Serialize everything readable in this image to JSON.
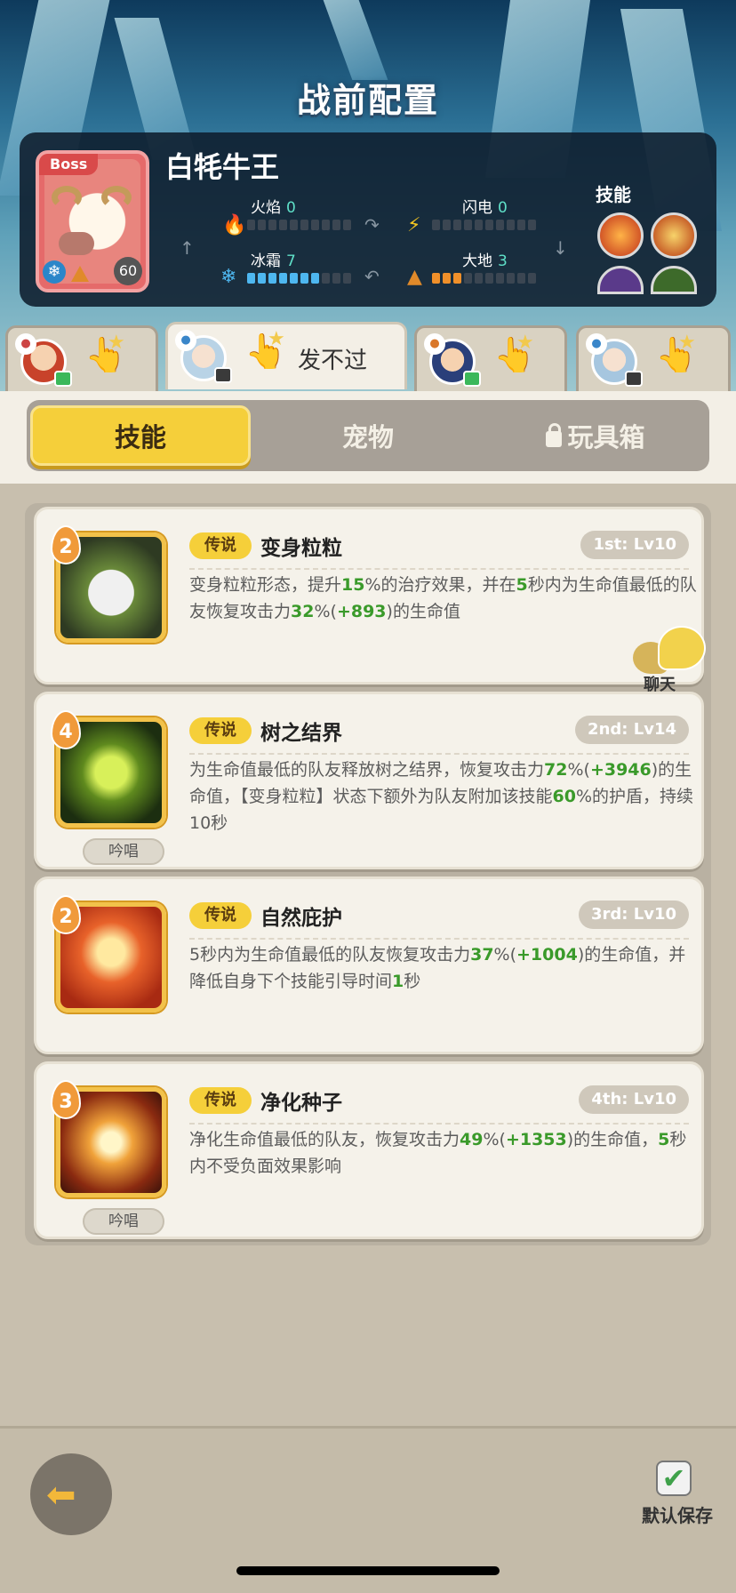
{
  "header": {
    "title": "战前配置"
  },
  "boss": {
    "tag": "Boss",
    "name": "白牦牛王",
    "level": "60",
    "elements": [
      {
        "name": "火焰",
        "value": "0"
      },
      {
        "name": "闪电",
        "value": "0"
      },
      {
        "name": "冰霜",
        "value": "7"
      },
      {
        "name": "大地",
        "value": "3"
      }
    ],
    "skills_label": "技能"
  },
  "hero_tabs": [
    {
      "label": ""
    },
    {
      "label": "发不过"
    },
    {
      "label": ""
    },
    {
      "label": ""
    }
  ],
  "categories": {
    "skills": "技能",
    "pets": "宠物",
    "toybox": "玩具箱"
  },
  "skills": [
    {
      "level": "2",
      "rarity": "传说",
      "name": "变身粒粒",
      "slot": "1st: Lv10",
      "desc": [
        "变身粒粒形态，提升",
        "15",
        "%的治疗效果，并在",
        "5",
        "秒内为生命值最低的队友恢复攻击力",
        "32",
        "%(",
        "+893",
        ")的生命值"
      ],
      "sing": ""
    },
    {
      "level": "4",
      "rarity": "传说",
      "name": "树之结界",
      "slot": "2nd: Lv14",
      "desc": [
        "为生命值最低的队友释放树之结界，恢复攻击力",
        "72",
        "%(",
        "+3946",
        ")的生命值，【变身粒粒】状态下额外为队友附加该技能",
        "60",
        "%的护盾，持续10秒"
      ],
      "sing": "吟唱"
    },
    {
      "level": "2",
      "rarity": "传说",
      "name": "自然庇护",
      "slot": "3rd: Lv10",
      "desc": [
        "5秒内为生命值最低的队友恢复攻击力",
        "37",
        "%(",
        "+1004",
        ")的生命值，并降低自身下个技能引导时间",
        "1",
        "秒"
      ],
      "sing": ""
    },
    {
      "level": "3",
      "rarity": "传说",
      "name": "净化种子",
      "slot": "4th: Lv10",
      "desc": [
        "净化生命值最低的队友，恢复攻击力",
        "49",
        "%(",
        "+1353",
        ")的生命值，",
        "5",
        "秒内不受负面效果影响"
      ],
      "sing": "吟唱"
    }
  ],
  "chat": {
    "label": "聊天"
  },
  "footer": {
    "save_label": "默认保存"
  },
  "colors": {
    "accent": "#f5cf3a",
    "highlight": "#3a9a2a",
    "panel": "#0e1c2c"
  }
}
